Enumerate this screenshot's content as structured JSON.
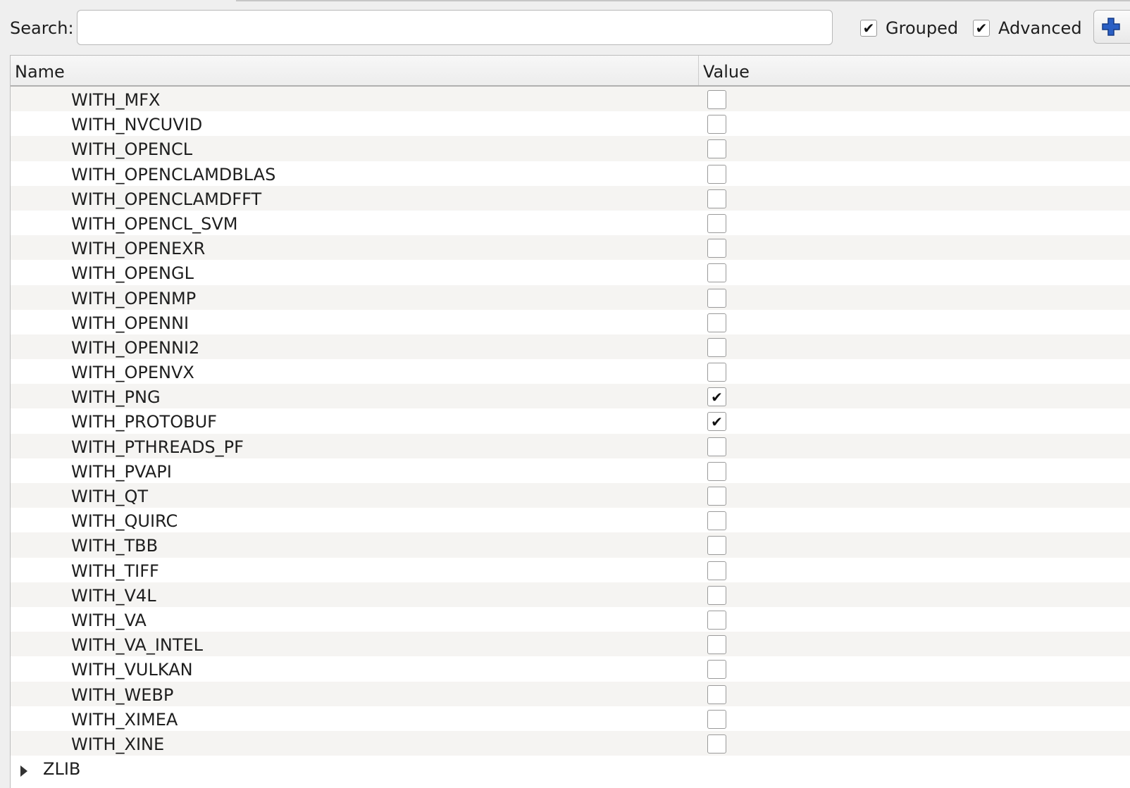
{
  "toolbar": {
    "search_label": "Search:",
    "search_value": "",
    "grouped": {
      "label": "Grouped",
      "checked": true
    },
    "advanced": {
      "label": "Advanced",
      "checked": true
    },
    "add_entry_icon": "plus-icon"
  },
  "table": {
    "headers": {
      "name": "Name",
      "value": "Value"
    },
    "rows": [
      {
        "name": "WITH_MFX",
        "checked": false
      },
      {
        "name": "WITH_NVCUVID",
        "checked": false
      },
      {
        "name": "WITH_OPENCL",
        "checked": false
      },
      {
        "name": "WITH_OPENCLAMDBLAS",
        "checked": false
      },
      {
        "name": "WITH_OPENCLAMDFFT",
        "checked": false
      },
      {
        "name": "WITH_OPENCL_SVM",
        "checked": false
      },
      {
        "name": "WITH_OPENEXR",
        "checked": false
      },
      {
        "name": "WITH_OPENGL",
        "checked": false
      },
      {
        "name": "WITH_OPENMP",
        "checked": false
      },
      {
        "name": "WITH_OPENNI",
        "checked": false
      },
      {
        "name": "WITH_OPENNI2",
        "checked": false
      },
      {
        "name": "WITH_OPENVX",
        "checked": false
      },
      {
        "name": "WITH_PNG",
        "checked": true
      },
      {
        "name": "WITH_PROTOBUF",
        "checked": true
      },
      {
        "name": "WITH_PTHREADS_PF",
        "checked": false
      },
      {
        "name": "WITH_PVAPI",
        "checked": false
      },
      {
        "name": "WITH_QT",
        "checked": false
      },
      {
        "name": "WITH_QUIRC",
        "checked": false
      },
      {
        "name": "WITH_TBB",
        "checked": false
      },
      {
        "name": "WITH_TIFF",
        "checked": false
      },
      {
        "name": "WITH_V4L",
        "checked": false
      },
      {
        "name": "WITH_VA",
        "checked": false
      },
      {
        "name": "WITH_VA_INTEL",
        "checked": false
      },
      {
        "name": "WITH_VULKAN",
        "checked": false
      },
      {
        "name": "WITH_WEBP",
        "checked": false
      },
      {
        "name": "WITH_XIMEA",
        "checked": false
      },
      {
        "name": "WITH_XINE",
        "checked": false
      }
    ],
    "next_group": {
      "name": "ZLIB",
      "icon": "expand-arrow-icon"
    }
  },
  "colors": {
    "row_alt": "#f5f4f2",
    "row": "#ffffff",
    "plus_icon": "#2a5fc4"
  }
}
